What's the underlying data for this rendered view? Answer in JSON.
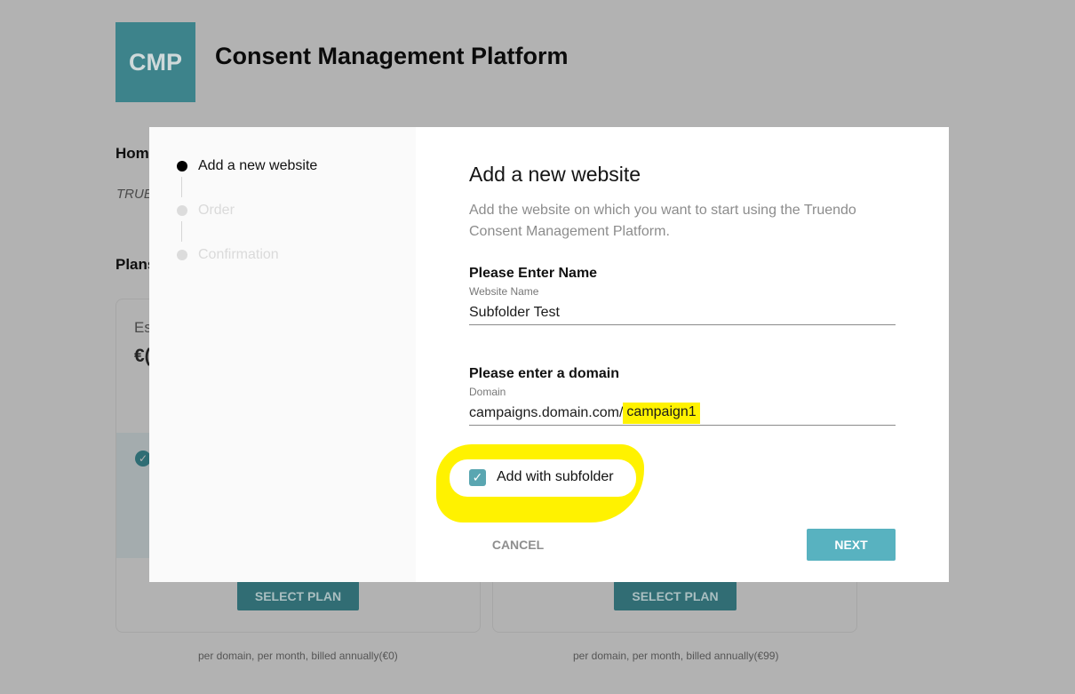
{
  "app": {
    "logo_text": "CMP",
    "title": "Consent Management Platform"
  },
  "background": {
    "home_label": "Hom",
    "subtitle": "TRUE",
    "plans_label": "Plans",
    "cards": [
      {
        "name": "Es",
        "price": "€(",
        "select_label": "SELECT PLAN",
        "billing_note": "per domain, per month, billed annually(€0)"
      },
      {
        "name": "",
        "price": "",
        "select_label": "SELECT PLAN",
        "billing_note": "per domain, per month, billed annually(€99)"
      }
    ]
  },
  "modal": {
    "steps": [
      {
        "label": "Add a new website",
        "active": true
      },
      {
        "label": "Order",
        "active": false
      },
      {
        "label": "Confirmation",
        "active": false
      }
    ],
    "title": "Add a new website",
    "description": "Add the website on which you want to start using the Truendo Consent Management Platform.",
    "name_field": {
      "heading": "Please Enter Name",
      "label": "Website Name",
      "value": "Subfolder Test"
    },
    "domain_field": {
      "heading": "Please enter a domain",
      "label": "Domain",
      "value_base": "campaigns.domain.com/",
      "value_highlight": "campaign1"
    },
    "subfolder_checkbox": {
      "label": "Add with subfolder",
      "checked": true
    },
    "cancel_label": "CANCEL",
    "next_label": "NEXT"
  },
  "colors": {
    "accent": "#58b2c0",
    "highlight": "#fff200",
    "logo_bg": "#3d838b",
    "overlay": "#b2b2b2"
  },
  "icons": {
    "checkbox": "check-icon",
    "step_active": "dot-filled-icon",
    "step_inactive": "dot-empty-icon"
  }
}
